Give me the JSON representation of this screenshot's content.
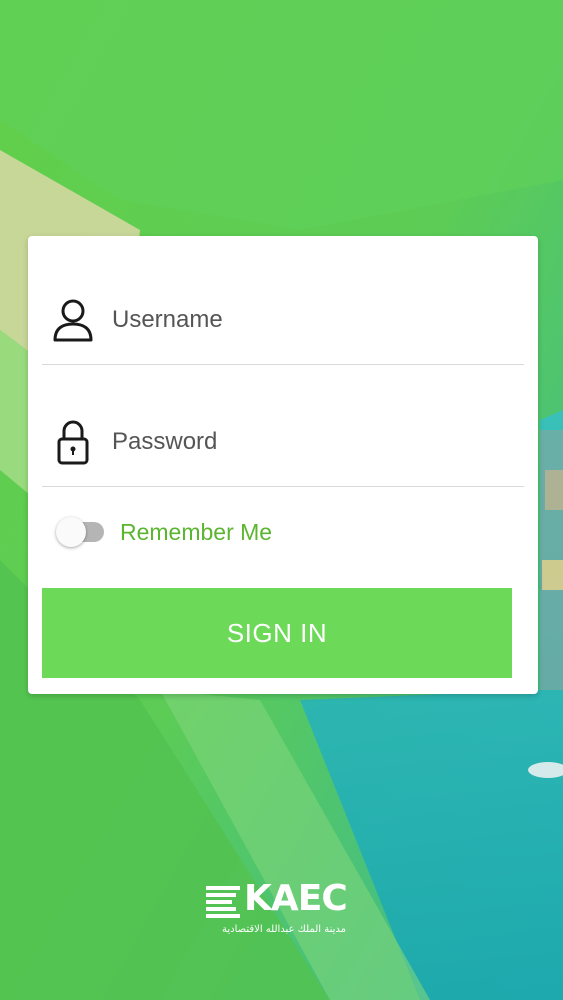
{
  "colors": {
    "accent": "#6dd958",
    "remember_label": "#5cb531",
    "background": "#5fcf4f"
  },
  "login": {
    "username": {
      "placeholder": "Username",
      "value": "",
      "icon": "user-icon"
    },
    "password": {
      "placeholder": "Password",
      "value": "",
      "icon": "lock-icon"
    },
    "remember_me": {
      "label": "Remember Me",
      "checked": false
    },
    "sign_in_label": "SIGN IN"
  },
  "logo": {
    "name": "KAEC",
    "arabic_name": "مدينة الملك عبدالله الاقتصادية"
  }
}
